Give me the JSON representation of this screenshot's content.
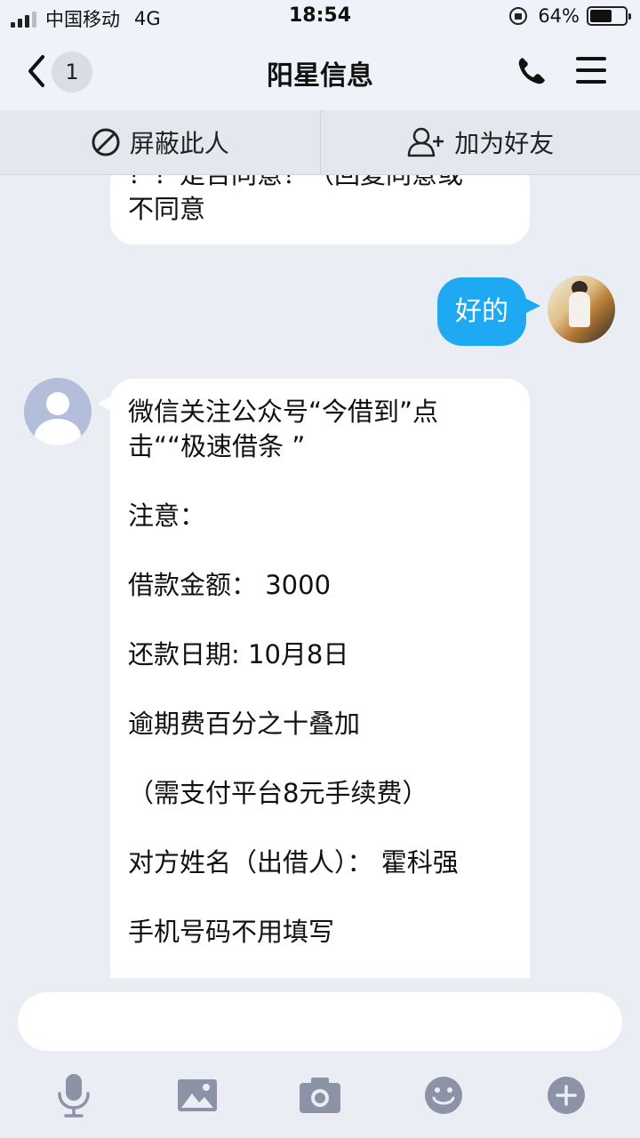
{
  "status_bar": {
    "carrier": "中国移动",
    "network": "4G",
    "time": "18:54",
    "battery": "64%",
    "battery_level": 0.64
  },
  "nav": {
    "unread_count": "1",
    "title": "阳星信息"
  },
  "actions": {
    "block": "屏蔽此人",
    "add_friend": "加为好友"
  },
  "messages": {
    "partial_incoming": {
      "line1": "？？是否同意？（回复同意或",
      "line2": "不同意"
    },
    "sent": "好的",
    "incoming": {
      "lines": [
        "微信关注公众号“今借到”点",
        "击““极速借条 ”",
        "",
        "注意：",
        "",
        "借款金额： 3000",
        "",
        "还款日期: 10月8日",
        "",
        "逾期费百分之十叠加",
        "",
        "（需支付平台8元手续费）",
        "",
        "对方姓名（出借人）： 霍科强",
        "",
        "手机号码不用填写"
      ]
    }
  },
  "input": {
    "placeholder": ""
  },
  "toolbar": {
    "icons": [
      "microphone-icon",
      "image-icon",
      "camera-icon",
      "emoji-icon",
      "plus-icon"
    ]
  },
  "colors": {
    "sent_bubble": "#1fa9f2",
    "background": "#eaedf4",
    "icon_gray": "#8d93a6"
  }
}
